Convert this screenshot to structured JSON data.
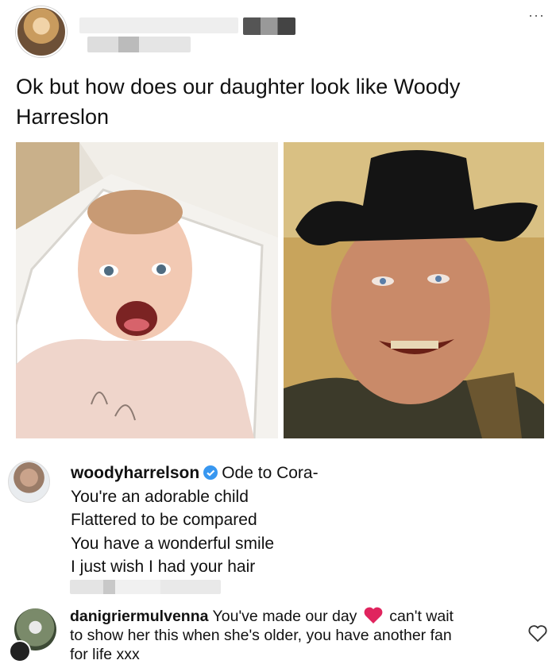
{
  "post": {
    "caption_line1": "Ok but how does our daughter look like Woody",
    "caption_line2": "Harreslon",
    "more_label": "···"
  },
  "comments": [
    {
      "username": "woodyharrelson",
      "lines": [
        "Ode to Cora-",
        "You're an adorable child",
        "Flattered to be compared",
        "You have a wonderful smile",
        "I just wish I had your hair"
      ]
    },
    {
      "username": "danigriermulvenna",
      "text_part1": "You've made our day",
      "text_part2": "can't wait",
      "line2": "to show her this when she's older, you have another fan",
      "line3": "for life xxx"
    }
  ],
  "colors": {
    "verified_badge": "#3897f0",
    "heart": "#e0245e"
  },
  "icons": {
    "verified": "verified-badge-icon",
    "heart": "heart-emoji-icon",
    "like": "heart-outline-icon",
    "more": "more-options-icon"
  }
}
